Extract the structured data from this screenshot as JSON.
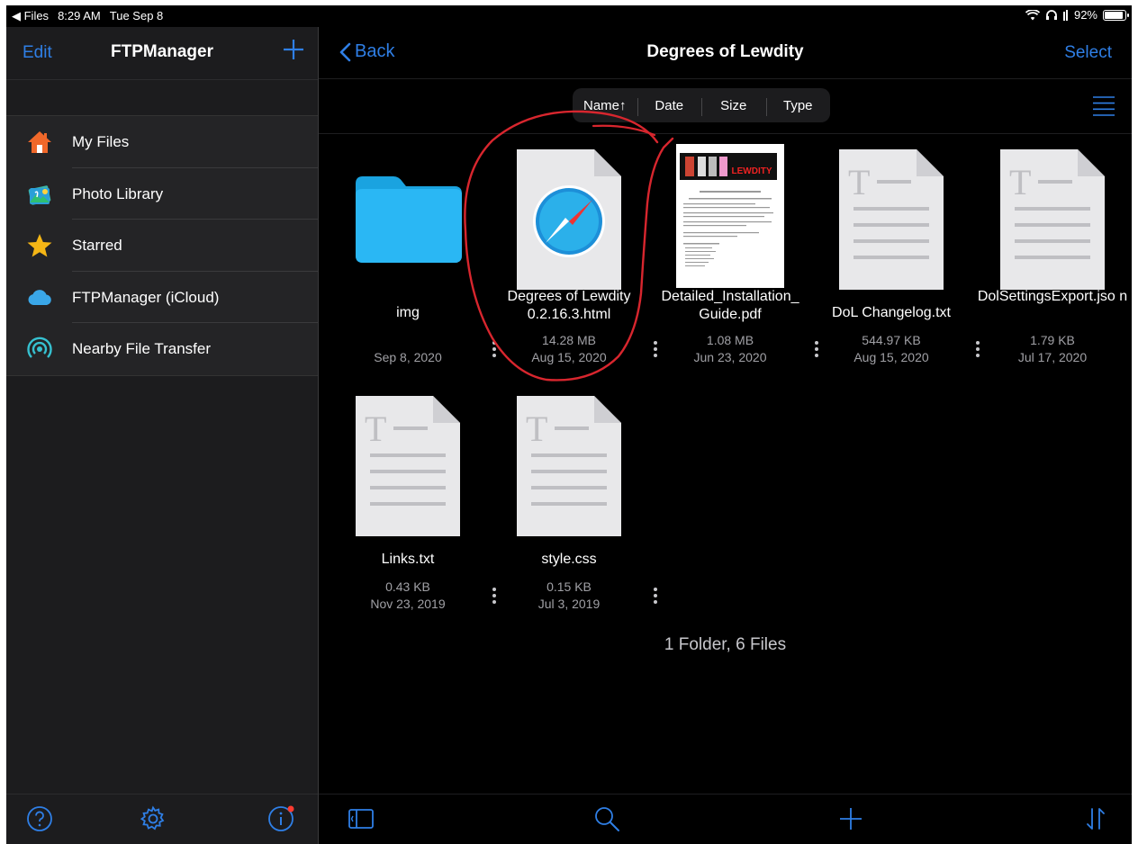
{
  "status_bar": {
    "back_app": "◀ Files",
    "time": "8:29 AM",
    "date": "Tue Sep 8",
    "battery": "92%",
    "battery_level": 0.92
  },
  "sidebar": {
    "edit_label": "Edit",
    "title": "FTPManager",
    "items": [
      {
        "label": "My Files",
        "icon": "home-icon"
      },
      {
        "label": "Photo Library",
        "icon": "photo-library-icon"
      },
      {
        "label": "Starred",
        "icon": "star-icon"
      },
      {
        "label": "FTPManager (iCloud)",
        "icon": "cloud-icon"
      },
      {
        "label": "Nearby File Transfer",
        "icon": "nearby-transfer-icon"
      }
    ]
  },
  "main": {
    "back_label": "Back",
    "title": "Degrees of Lewdity",
    "select_label": "Select",
    "sort": [
      {
        "label": "Name↑"
      },
      {
        "label": "Date"
      },
      {
        "label": "Size"
      },
      {
        "label": "Type"
      }
    ],
    "files": [
      {
        "name": "img",
        "size": "",
        "date": "Sep 8, 2020",
        "kind": "folder"
      },
      {
        "name": "Degrees of Lewdity 0.2.16.3.html",
        "size": "14.28 MB",
        "date": "Aug 15, 2020",
        "kind": "html"
      },
      {
        "name": "Detailed_Installation_ Guide.pdf",
        "size": "1.08 MB",
        "date": "Jun 23, 2020",
        "kind": "pdf"
      },
      {
        "name": "DoL Changelog.txt",
        "size": "544.97 KB",
        "date": "Aug 15, 2020",
        "kind": "text"
      },
      {
        "name": "DolSettingsExport.jso n",
        "size": "1.79 KB",
        "date": "Jul 17, 2020",
        "kind": "text"
      },
      {
        "name": "Links.txt",
        "size": "0.43 KB",
        "date": "Nov 23, 2019",
        "kind": "text"
      },
      {
        "name": "style.css",
        "size": "0.15 KB",
        "date": "Jul 3, 2019",
        "kind": "text"
      }
    ],
    "pdf_thumb_banner": "LEWDITY",
    "summary": "1 Folder, 6 Files"
  },
  "colors": {
    "accent": "#2f7fe6",
    "annotation": "#d8262e",
    "folder": "#28b4f2"
  }
}
